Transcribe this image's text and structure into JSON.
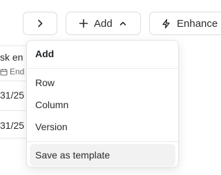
{
  "toolbar": {
    "chevron_icon": "chevron-right-icon",
    "add": {
      "icon": "plus-icon",
      "label": "Add",
      "caret_icon": "chevron-up-icon"
    },
    "enhance": {
      "icon": "lightning-icon",
      "label": "Enhance"
    }
  },
  "background_table": {
    "header_task": "sk en",
    "header_end_icon": "calendar-icon",
    "header_end": "End",
    "rows": [
      {
        "date": "31/25"
      },
      {
        "date": "31/25"
      }
    ]
  },
  "add_menu": {
    "header": "Add",
    "items": [
      "Row",
      "Column",
      "Version"
    ],
    "save_as_template": "Save as template"
  }
}
